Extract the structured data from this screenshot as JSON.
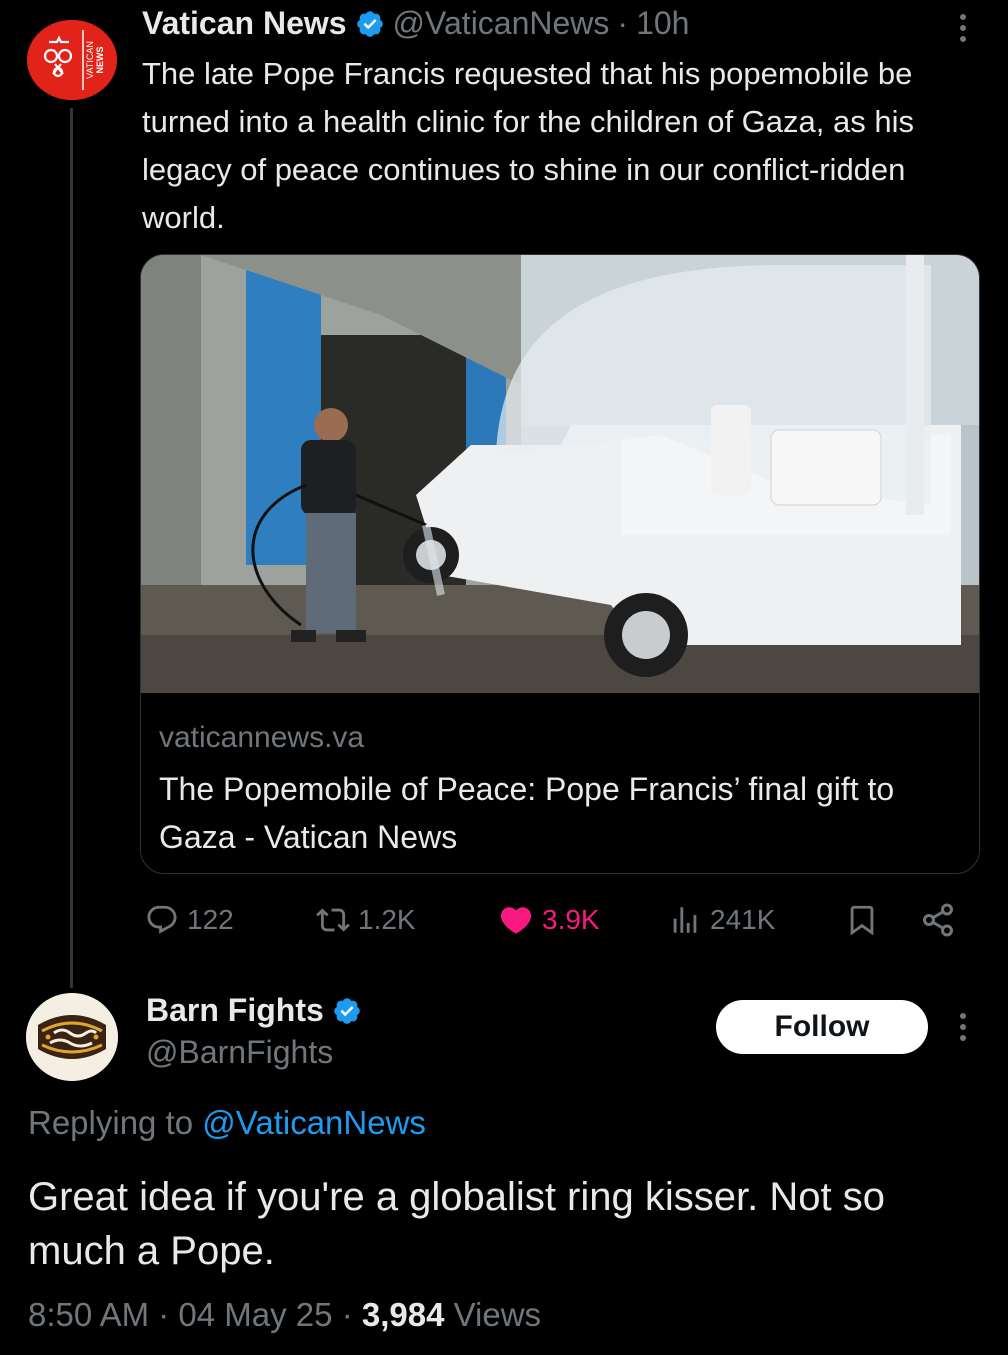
{
  "tweet": {
    "author_name": "Vatican News",
    "handle": "@VaticanNews",
    "separator": "·",
    "time": "10h",
    "text": "The late Pope Francis requested that his popemobile be turned into a health clinic for the children of Gaza, as his legacy of peace continues to shine in our conflict-ridden world.",
    "avatar_text": "VATICAN NEWS",
    "card": {
      "domain": "vaticannews.va",
      "title": "The Popemobile of Peace: Pope Francis’ final gift to Gaza - Vatican News"
    },
    "actions": {
      "replies": "122",
      "reposts": "1.2K",
      "likes": "3.9K",
      "views": "241K"
    }
  },
  "reply": {
    "author_name": "Barn Fights",
    "handle": "@BarnFights",
    "avatar_text": "Barn Fights",
    "follow_label": "Follow",
    "replying_prefix": "Replying to",
    "replying_to": "@VaticanNews",
    "text": "Great idea if you're a globalist ring kisser. Not so much a Pope.",
    "time": "8:50 AM",
    "date": "04 May 25",
    "views_count": "3,984",
    "views_label": "Views",
    "separator": "·"
  },
  "icons": {
    "verified": "verified-badge-icon",
    "more": "more-icon",
    "reply": "reply-icon",
    "repost": "repost-icon",
    "like": "heart-icon",
    "views": "views-icon",
    "bookmark": "bookmark-icon",
    "share": "share-icon"
  },
  "colors": {
    "background": "#000000",
    "text": "#e7e9ea",
    "muted": "#71767b",
    "accent": "#1d9bf0",
    "like": "#f91880",
    "vatican_red": "#e2231a"
  }
}
